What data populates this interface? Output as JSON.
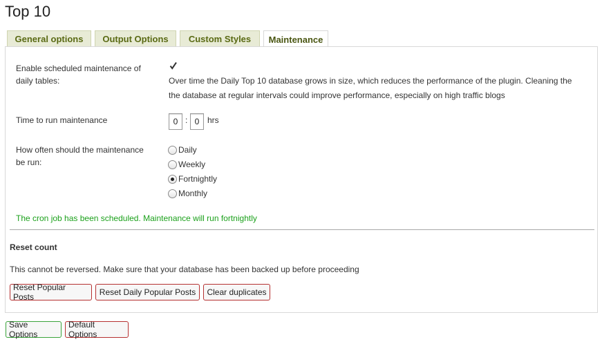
{
  "page": {
    "title": "Top 10"
  },
  "tabs": [
    {
      "label": "General options"
    },
    {
      "label": "Output Options"
    },
    {
      "label": "Custom Styles"
    },
    {
      "label": "Maintenance",
      "active": true
    }
  ],
  "maintenance": {
    "enable_label_line1": "Enable scheduled maintenance of",
    "enable_label_line2": "daily tables:",
    "enable_checked": true,
    "description_line1": "Over time the Daily Top 10 database grows in size, which reduces the performance of the plugin. Cleaning the",
    "description_line2": "the database at regular intervals could improve performance, especially on high traffic blogs",
    "time_label": "Time to run maintenance",
    "hour_value": "0",
    "minute_value": "0",
    "time_separator": ":",
    "time_unit": "hrs",
    "frequency_label_line1": "How often should the maintenance",
    "frequency_label_line2": "be run:",
    "frequency_options": [
      {
        "label": "Daily",
        "checked": false
      },
      {
        "label": "Weekly",
        "checked": false
      },
      {
        "label": "Fortnightly",
        "checked": true
      },
      {
        "label": "Monthly",
        "checked": false
      }
    ],
    "status_message": "The cron job has been scheduled. Maintenance will run fortnightly",
    "status_color": "#1ca11c"
  },
  "reset": {
    "title": "Reset count",
    "warning": "This cannot be reversed. Make sure that your database has been backed up before proceeding",
    "buttons": [
      "Reset Popular Posts",
      "Reset Daily Popular Posts",
      "Clear duplicates"
    ]
  },
  "footer": {
    "save_label": "Save Options",
    "default_label": "Default Options"
  },
  "colors": {
    "tab_text": "#5a6a14",
    "danger_border": "#b53030",
    "save_border": "#3aa33a"
  }
}
